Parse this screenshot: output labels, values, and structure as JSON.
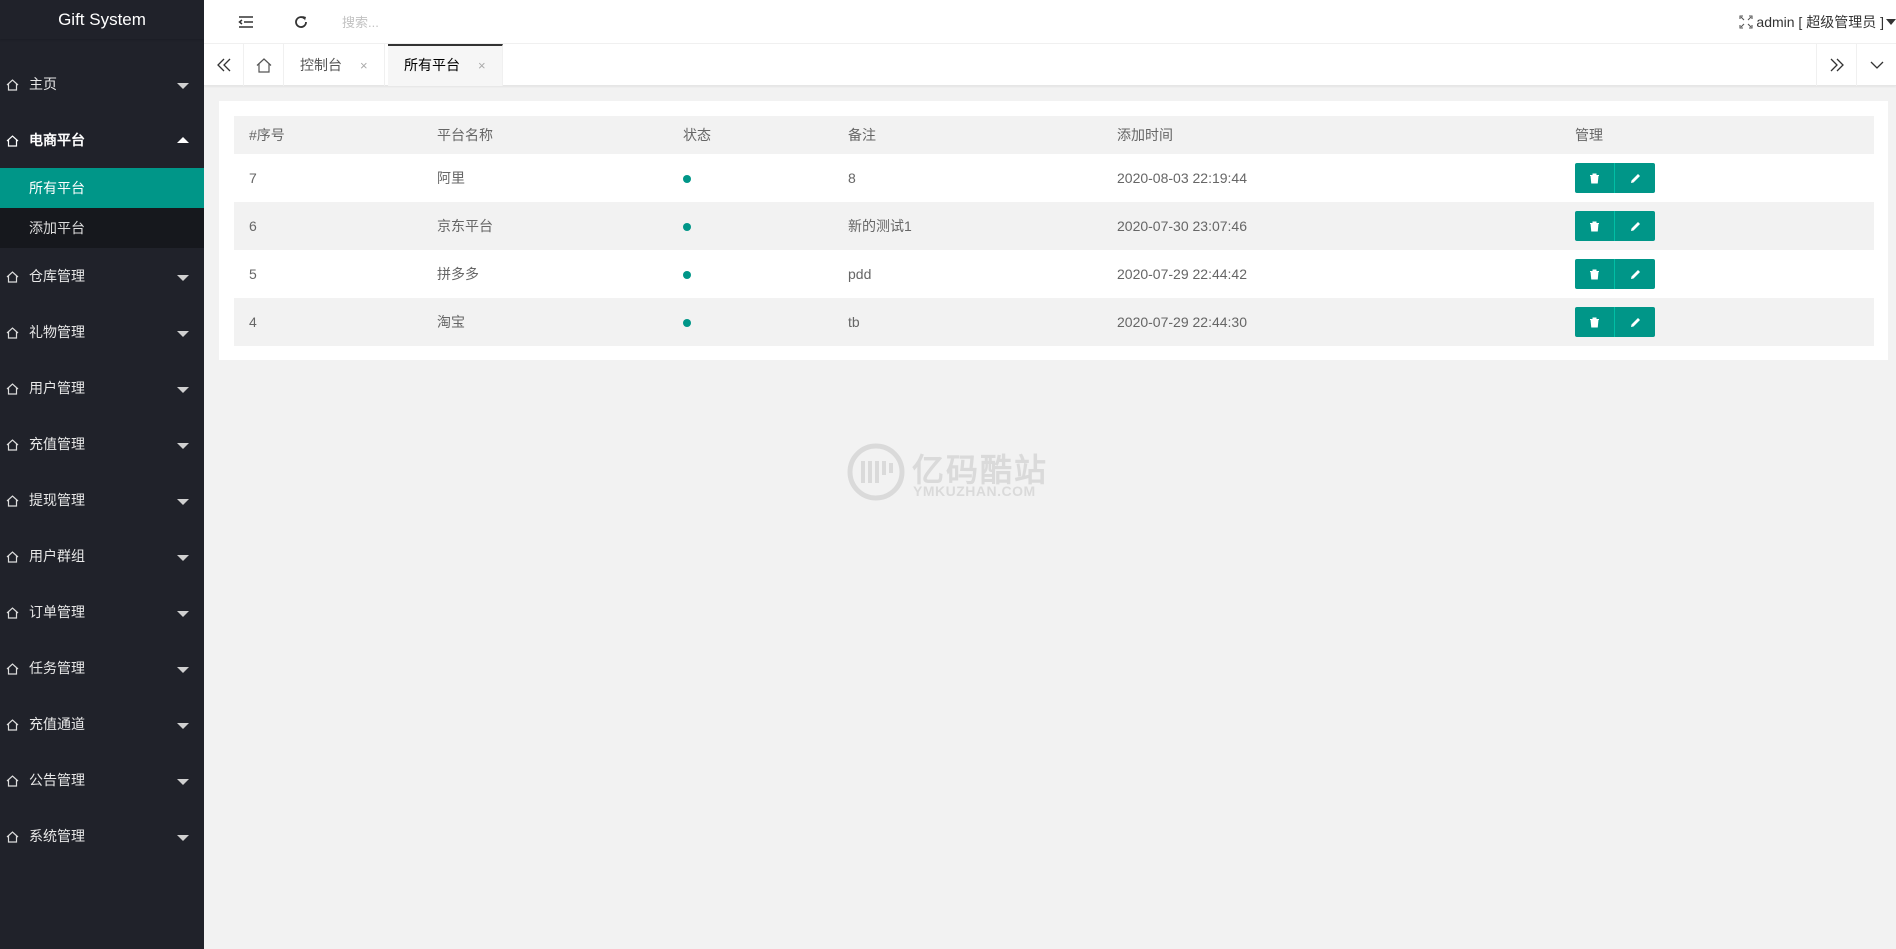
{
  "app": {
    "title": "Gift System"
  },
  "sidebar": {
    "items": [
      {
        "label": "主页",
        "expanded": false
      },
      {
        "label": "电商平台",
        "expanded": true,
        "children": [
          {
            "label": "所有平台",
            "active": true
          },
          {
            "label": "添加平台",
            "active": false
          }
        ]
      },
      {
        "label": "仓库管理",
        "expanded": false
      },
      {
        "label": "礼物管理",
        "expanded": false
      },
      {
        "label": "用户管理",
        "expanded": false
      },
      {
        "label": "充值管理",
        "expanded": false
      },
      {
        "label": "提现管理",
        "expanded": false
      },
      {
        "label": "用户群组",
        "expanded": false
      },
      {
        "label": "订单管理",
        "expanded": false
      },
      {
        "label": "任务管理",
        "expanded": false
      },
      {
        "label": "充值通道",
        "expanded": false
      },
      {
        "label": "公告管理",
        "expanded": false
      },
      {
        "label": "系统管理",
        "expanded": false
      }
    ]
  },
  "header": {
    "search_placeholder": "搜索...",
    "user_label": "admin [ 超级管理员 ]"
  },
  "tabs": [
    {
      "label": "控制台",
      "close": "×",
      "active": false
    },
    {
      "label": "所有平台",
      "close": "×",
      "active": true
    }
  ],
  "table": {
    "columns": [
      "#序号",
      "平台名称",
      "状态",
      "备注",
      "添加时间",
      "管理"
    ],
    "rows": [
      {
        "id": "7",
        "name": "阿里",
        "status": "active",
        "note": "8",
        "time": "2020-08-03 22:19:44"
      },
      {
        "id": "6",
        "name": "京东平台",
        "status": "active",
        "note": "新的测试1",
        "time": "2020-07-30 23:07:46"
      },
      {
        "id": "5",
        "name": "拼多多",
        "status": "active",
        "note": "pdd",
        "time": "2020-07-29 22:44:42"
      },
      {
        "id": "4",
        "name": "淘宝",
        "status": "active",
        "note": "tb",
        "time": "2020-07-29 22:44:30"
      }
    ]
  },
  "watermark": {
    "title": "亿码酷站",
    "subtitle": "YMKUZHAN.COM"
  },
  "colors": {
    "accent": "#009688",
    "sidebar_bg": "#20222a",
    "sidebar_sub_bg": "#16181d"
  }
}
